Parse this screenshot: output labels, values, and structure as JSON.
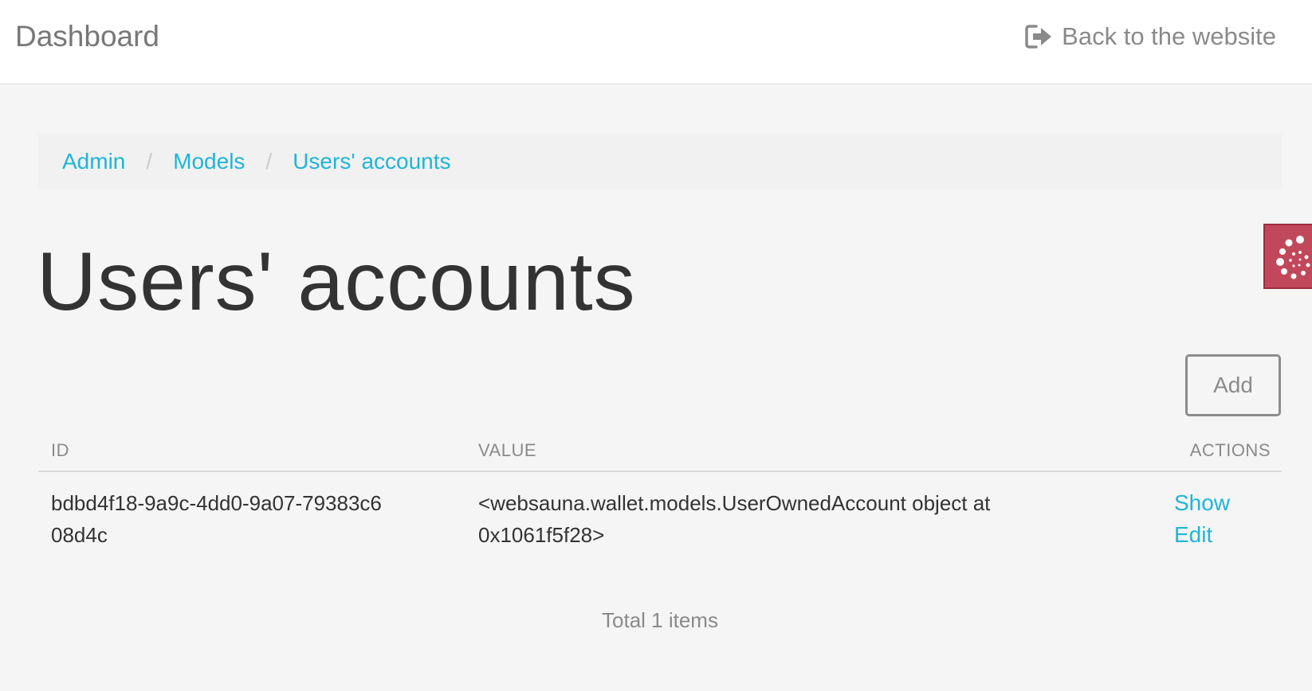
{
  "navbar": {
    "brand": "Dashboard",
    "back_link_label": "Back to the website",
    "back_link_icon": "sign-out-icon"
  },
  "breadcrumb": {
    "items": [
      "Admin",
      "Models",
      "Users' accounts"
    ],
    "separator": "/"
  },
  "page": {
    "title": "Users' accounts"
  },
  "toolbar": {
    "add_label": "Add"
  },
  "table": {
    "columns": [
      "ID",
      "VALUE",
      "ACTIONS"
    ],
    "rows": [
      {
        "id": "bdbd4f18-9a9c-4dd0-9a07-79383c608d4c",
        "value": "<websauna.wallet.models.UserOwnedAccount object at 0x1061f5f28>",
        "actions": [
          "Show",
          "Edit"
        ]
      }
    ]
  },
  "footer": {
    "total_text": "Total 1 items"
  },
  "colors": {
    "link": "#1fb5d8",
    "badge": "#c0485a",
    "background": "#f5f5f5"
  }
}
